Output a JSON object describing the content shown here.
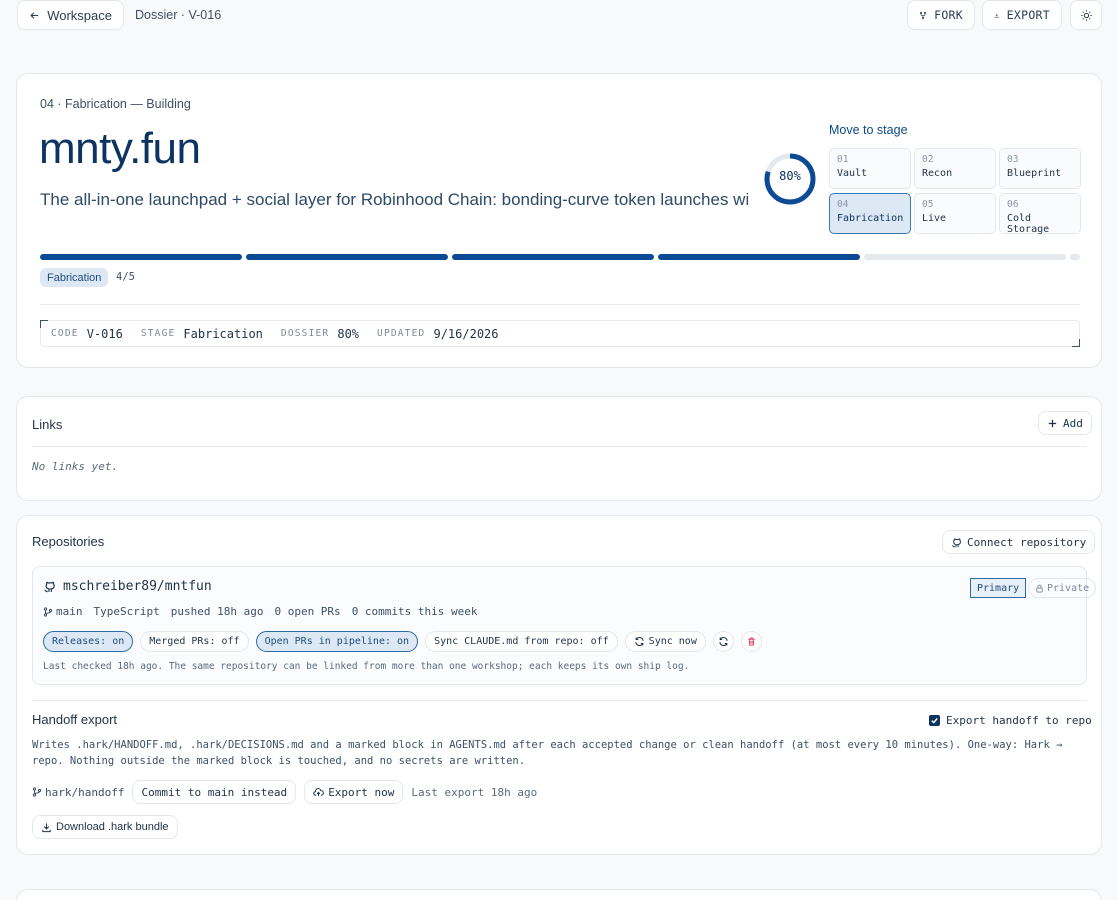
{
  "topbar": {
    "back_label": "Workspace",
    "breadcrumb": "Dossier · V-016",
    "fork_label": "FORK",
    "export_label": "EXPORT"
  },
  "hero": {
    "kicker": "04 · Fabrication — Building",
    "title": "mnty.fun",
    "tagline": "The all-in-one launchpad + social layer for Robinhood Chain: bonding-curve token launches with",
    "ring_percent": 80,
    "ring_label": "80%",
    "move_to_stage": "Move to stage",
    "stages": [
      {
        "num": "01",
        "name": "Vault",
        "active": false
      },
      {
        "num": "02",
        "name": "Recon",
        "active": false
      },
      {
        "num": "03",
        "name": "Blueprint",
        "active": false
      },
      {
        "num": "04",
        "name": "Fabrication",
        "active": true
      },
      {
        "num": "05",
        "name": "Live",
        "active": false
      },
      {
        "num": "06",
        "name": "Cold Storage",
        "active": false
      }
    ],
    "progress_completed": 4,
    "progress_total": 5,
    "stage_badge": "Fabrication",
    "progress_label": "4/5",
    "meta": {
      "code_key": "CODE",
      "code": "V-016",
      "stage_key": "STAGE",
      "stage": "Fabrication",
      "dossier_key": "DOSSIER",
      "dossier": "80%",
      "updated_key": "UPDATED",
      "updated": "9/16/2026"
    }
  },
  "links": {
    "title": "Links",
    "add_label": "Add",
    "empty": "No links yet."
  },
  "repos": {
    "title": "Repositories",
    "connect_label": "Connect repository",
    "repo": {
      "name": "mschreiber89/mntfun",
      "primary": "Primary",
      "private": "Private",
      "branch": "main",
      "language": "TypeScript",
      "pushed": "pushed 18h ago",
      "open_prs": "0 open PRs",
      "commits": "0 commits this week",
      "chips": [
        {
          "label": "Releases: on",
          "on": true
        },
        {
          "label": "Merged PRs: off",
          "on": false
        },
        {
          "label": "Open PRs in pipeline: on",
          "on": true
        },
        {
          "label": "Sync CLAUDE.md from repo: off",
          "on": false
        }
      ],
      "sync_label": "Sync now",
      "note": "Last checked 18h ago. The same repository can be linked from more than one workshop; each keeps its own ship log."
    },
    "handoff": {
      "title": "Handoff export",
      "checkbox_label": "Export handoff to repo",
      "description": "Writes .hark/HANDOFF.md, .hark/DECISIONS.md and a marked block in AGENTS.md after each accepted change or clean handoff (at most every 10 minutes). One-way: Hark → repo. Nothing outside the marked block is touched, and no secrets are written.",
      "branch": "hark/handoff",
      "commit_main": "Commit to main instead",
      "export_now": "Export now",
      "last_export": "Last export 18h ago",
      "download": "Download .hark bundle"
    }
  },
  "colors": {
    "accent": "#0d4a96",
    "title": "#0d3461",
    "chip_on_bg": "#dce8f3",
    "danger": "#d9485f"
  }
}
